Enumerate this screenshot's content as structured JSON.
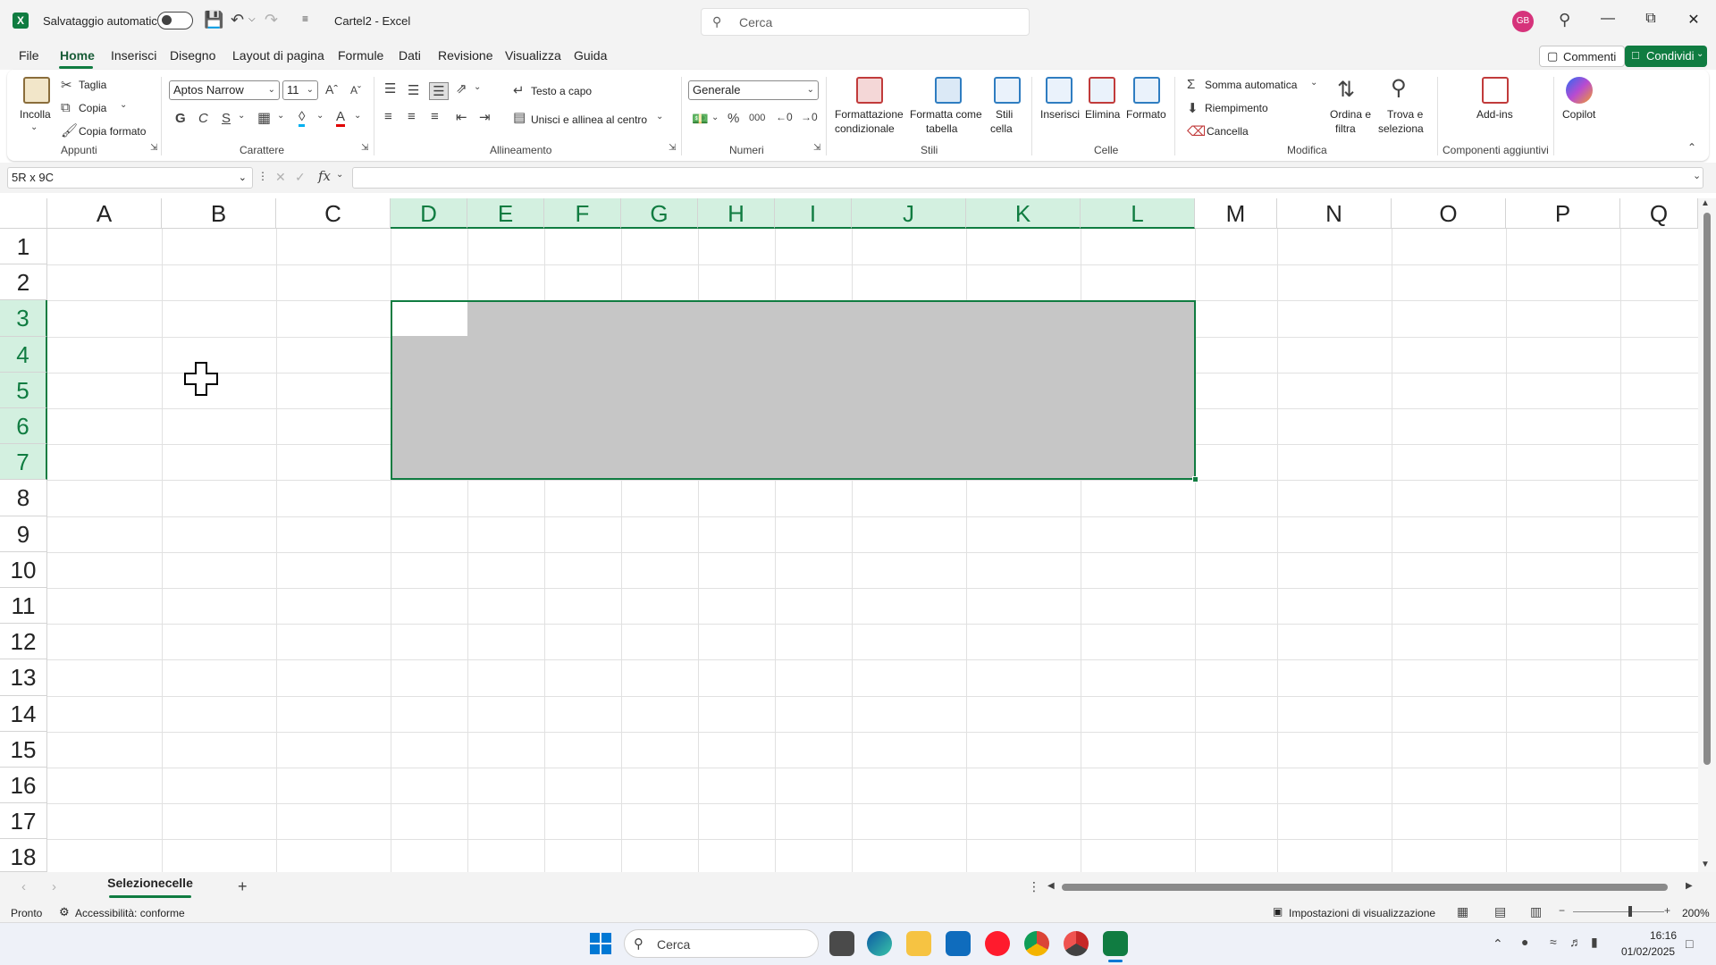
{
  "titlebar": {
    "autosave_label": "Salvataggio automatico",
    "doc_title": "Cartel2 - Excel",
    "search_placeholder": "Cerca",
    "user_initials": "GB",
    "minimize": "—",
    "maximize": "⧉",
    "close": "✕"
  },
  "menu": {
    "tabs": [
      "File",
      "Home",
      "Inserisci",
      "Disegno",
      "Layout di pagina",
      "Formule",
      "Dati",
      "Revisione",
      "Visualizza",
      "Guida"
    ],
    "comments": "Commenti",
    "share": "Condividi"
  },
  "ribbon": {
    "clipboard": {
      "paste": "Incolla",
      "cut": "Taglia",
      "copy": "Copia",
      "format_painter": "Copia formato",
      "group": "Appunti"
    },
    "font": {
      "name": "Aptos Narrow",
      "size": "11",
      "bold": "G",
      "italic": "C",
      "underline": "S",
      "group": "Carattere"
    },
    "alignment": {
      "wrap": "Testo a capo",
      "merge": "Unisci e allinea al centro",
      "group": "Allineamento"
    },
    "number": {
      "format": "Generale",
      "group": "Numeri"
    },
    "styles": {
      "conditional": "Formattazione",
      "conditional2": "condizionale",
      "table": "Formatta come",
      "table2": "tabella",
      "cell_styles": "Stili",
      "cell_styles2": "cella",
      "group": "Stili"
    },
    "cells": {
      "insert": "Inserisci",
      "delete": "Elimina",
      "format": "Formato",
      "group": "Celle"
    },
    "editing": {
      "autosum": "Somma automatica",
      "fill": "Riempimento",
      "clear": "Cancella",
      "sort": "Ordina e",
      "sort2": "filtra",
      "find": "Trova e",
      "find2": "seleziona",
      "group": "Modifica"
    },
    "addins": {
      "label": "Add-ins",
      "group": "Componenti aggiuntivi"
    },
    "copilot": {
      "label": "Copilot"
    }
  },
  "formula_bar": {
    "name_box": "5R x 9C",
    "fx": "fx",
    "value": ""
  },
  "grid": {
    "columns": [
      "A",
      "B",
      "C",
      "D",
      "E",
      "F",
      "G",
      "H",
      "I",
      "J",
      "K",
      "L",
      "M",
      "N",
      "O",
      "P",
      "Q"
    ],
    "rows": [
      "1",
      "2",
      "3",
      "4",
      "5",
      "6",
      "7",
      "8",
      "9",
      "10",
      "11",
      "12",
      "13",
      "14",
      "15",
      "16",
      "17",
      "18"
    ],
    "selection_range": "D3:L7",
    "active_cell": "D3"
  },
  "sheets": {
    "tabs": [
      "Selezionecelle"
    ],
    "add": "+"
  },
  "status": {
    "ready": "Pronto",
    "accessibility": "Accessibilità: conforme",
    "display_settings": "Impostazioni di visualizzazione",
    "zoom": "200%"
  },
  "taskbar": {
    "search": "Cerca",
    "time": "16:16",
    "date": "01/02/2025"
  },
  "colors": {
    "accent": "#107c41",
    "selection": "#c6c6c6",
    "header_selected": "#d3f0e0"
  }
}
